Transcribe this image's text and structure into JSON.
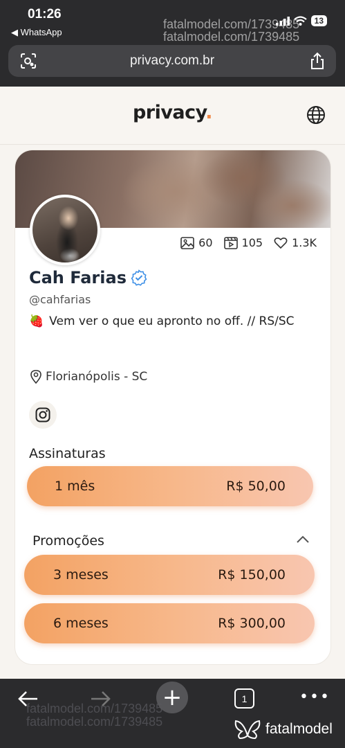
{
  "status_bar": {
    "time": "01:26",
    "back_app": "◀ WhatsApp",
    "battery": "13"
  },
  "watermark": {
    "text": "fatalmodel.com/1739485"
  },
  "browser": {
    "url": "privacy.com.br",
    "tab_count": "1"
  },
  "site": {
    "brand": "privacy",
    "brand_dot": "."
  },
  "profile": {
    "stats": {
      "images": "60",
      "videos": "105",
      "likes": "1.3K"
    },
    "name": "Cah Farias",
    "handle": "@cahfarias",
    "bio_emoji": "🍓",
    "bio": "Vem ver o que eu apronto no off. // RS/SC",
    "location": "Florianópolis - SC"
  },
  "subscriptions": {
    "title": "Assinaturas",
    "plan": {
      "label": "1 mês",
      "price": "R$ 50,00"
    }
  },
  "promotions": {
    "title": "Promoções",
    "plans": [
      {
        "label": "3 meses",
        "price": "R$ 150,00"
      },
      {
        "label": "6 meses",
        "price": "R$ 300,00"
      }
    ]
  },
  "footer": {
    "logo_text": "fatalmodel"
  },
  "colors": {
    "accent": "#f08a4b",
    "plan_gradient_start": "#f3a263",
    "plan_gradient_end": "#f8c6b0",
    "chrome": "#2b2b2d"
  }
}
